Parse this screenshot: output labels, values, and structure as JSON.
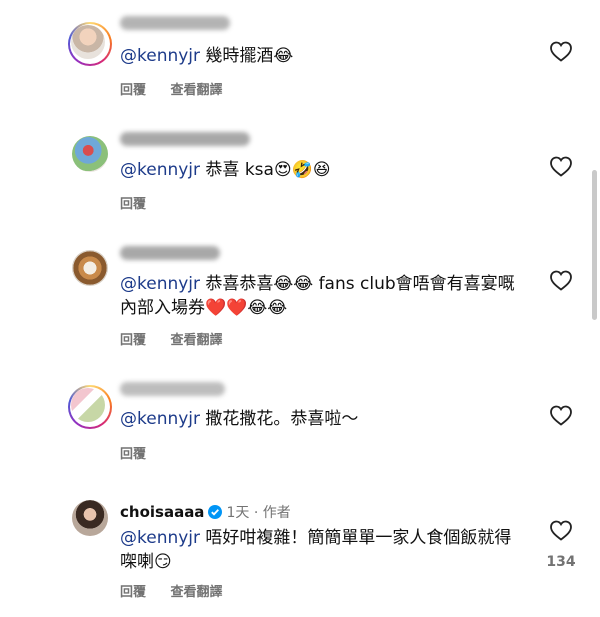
{
  "actions": {
    "reply": "回覆",
    "translate": "查看翻譯"
  },
  "comments": [
    {
      "text_mention": "@kennyjr",
      "text_body": " 幾時擺酒😂",
      "has_translate": true
    },
    {
      "text_mention": "@kennyjr",
      "text_body": " 恭喜 ksa😍🤣😆",
      "has_translate": false
    },
    {
      "text_mention": "@kennyjr",
      "text_body": " 恭喜恭喜😂😂 fans club會唔會有喜宴嘅內部入場券❤️❤️😂😂",
      "has_translate": true
    },
    {
      "text_mention": "@kennyjr",
      "text_body": " 撒花撒花。恭喜啦～",
      "has_translate": false
    },
    {
      "username": "choisaaaa",
      "time": "1天",
      "separator": "·",
      "author_tag": "作者",
      "text_mention": "@kennyjr",
      "text_body": " 唔好咁複雜！簡簡單單一家人食個飯就得㗎喇😏",
      "has_translate": true,
      "like_count": "134"
    }
  ],
  "icons": {
    "like": "heart-outline-icon",
    "verified": "verified-badge-icon"
  },
  "colors": {
    "mention": "#1d3b8a",
    "secondary": "#737373",
    "verified": "#0095f6"
  }
}
